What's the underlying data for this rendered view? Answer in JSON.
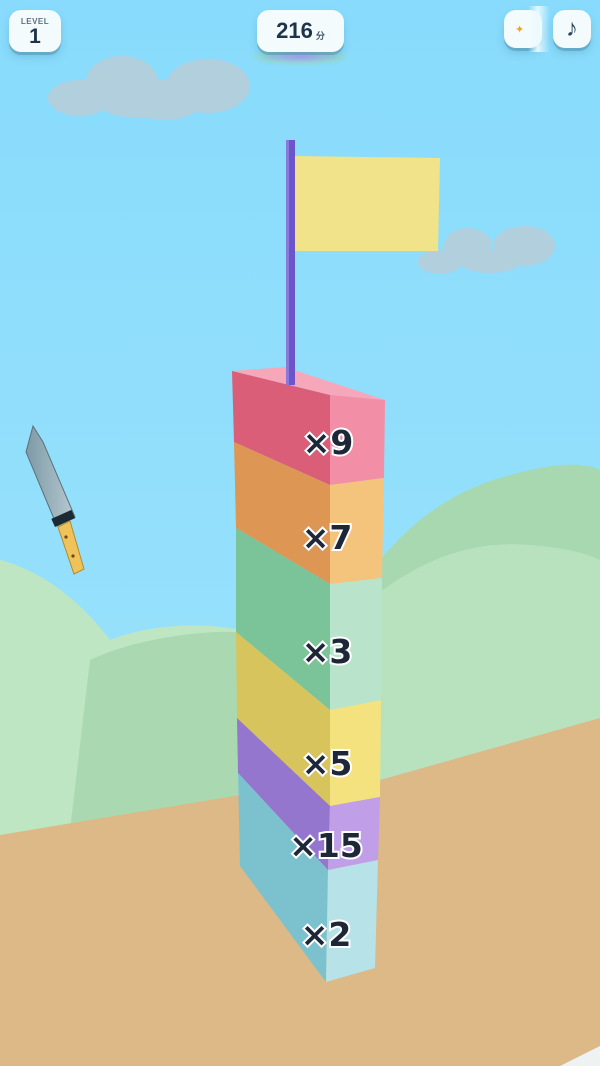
{
  "hud": {
    "level_label": "LEVEL",
    "level_value": "1",
    "score_value": "216",
    "score_unit": "分",
    "bonus_icon": "star-icon",
    "music_icon": "music-note-icon",
    "music_glyph": "♪",
    "star_glyph": "✦"
  },
  "tower": {
    "blocks": [
      {
        "label": "×9",
        "color": "#f08ca6"
      },
      {
        "label": "×7",
        "color": "#f2c27c"
      },
      {
        "label": "×3",
        "color": "#b8e4cc"
      },
      {
        "label": "×5",
        "color": "#f2e27e"
      },
      {
        "label": "×15",
        "color": "#bf9de8"
      },
      {
        "label": "×2",
        "color": "#b4e0e6"
      }
    ],
    "flag_color": "#f0e38a",
    "pole_color": "#6b55c9"
  },
  "colors": {
    "sky": "#8cdcfb",
    "ground": "#dcb987",
    "hills": "#b8e1bb"
  }
}
